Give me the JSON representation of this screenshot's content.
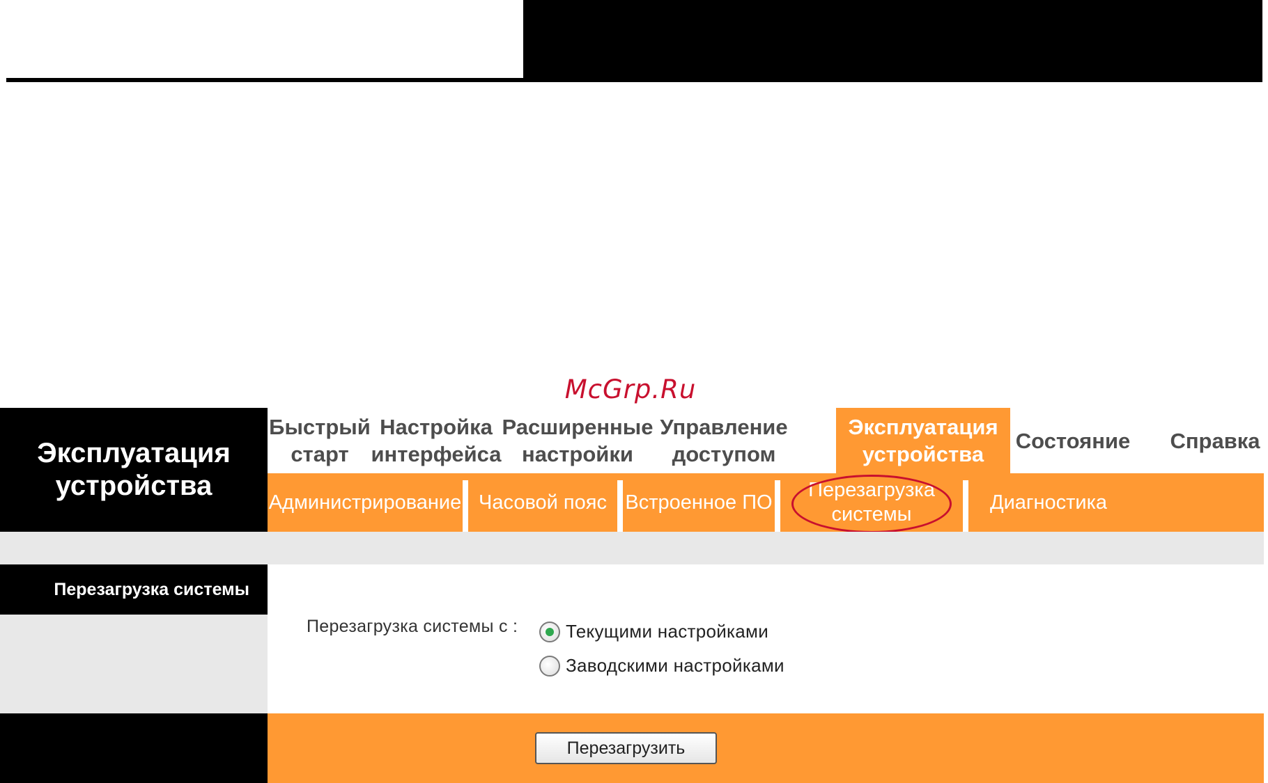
{
  "watermark": "McGrp.Ru",
  "sidebar": {
    "page_title": "Эксплуатация устройства",
    "section_label": "Перезагрузка системы"
  },
  "main_nav": {
    "items": [
      {
        "label": "Быстрый\nстарт",
        "active": false
      },
      {
        "label": "Настройка\nинтерфейса",
        "active": false
      },
      {
        "label": "Расширенные\nнастройки",
        "active": false
      },
      {
        "label": "Управление\nдоступом",
        "active": false
      },
      {
        "label": "Эксплуатация\nустройства",
        "active": true
      },
      {
        "label": "Состояние",
        "active": false
      },
      {
        "label": "Справка",
        "active": false
      }
    ]
  },
  "sub_nav": {
    "items": [
      {
        "label": "Администрирование",
        "active": false
      },
      {
        "label": "Часовой пояс",
        "active": false
      },
      {
        "label": "Встроенное ПО",
        "active": false
      },
      {
        "label": "Перезагрузка\nсистемы",
        "active": true
      },
      {
        "label": "Диагностика",
        "active": false
      }
    ]
  },
  "reboot": {
    "label": "Перезагрузка системы с :",
    "options": [
      {
        "label": "Текущими настройками",
        "checked": true
      },
      {
        "label": "Заводскими настройками",
        "checked": false
      }
    ],
    "button_label": "Перезагрузить"
  },
  "colors": {
    "accent_orange": "#ff9933",
    "highlight_red": "#c8102e",
    "panel_black": "#000000",
    "panel_gray": "#e8e8e8"
  }
}
